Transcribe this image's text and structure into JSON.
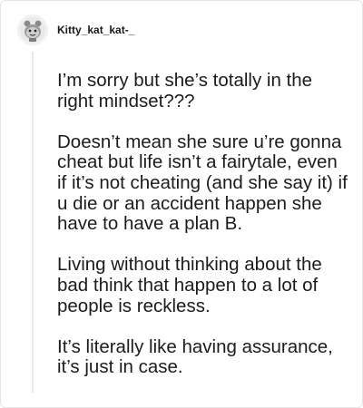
{
  "comment": {
    "username": "Kitty_kat_kat-_",
    "avatar_icon": "reddit-snoo-avatar",
    "paragraphs": [
      "I’m sorry but she’s totally in the right mindset???",
      "Doesn’t mean she sure u’re gonna cheat but life isn’t a fairytale, even if it’s not cheating (and she say it) if u die or an accident happen she have to have a plan B.",
      "Living without thinking about the bad think that happen to a lot of people is reckless.",
      "It’s literally like having assurance, it’s just in case."
    ]
  }
}
